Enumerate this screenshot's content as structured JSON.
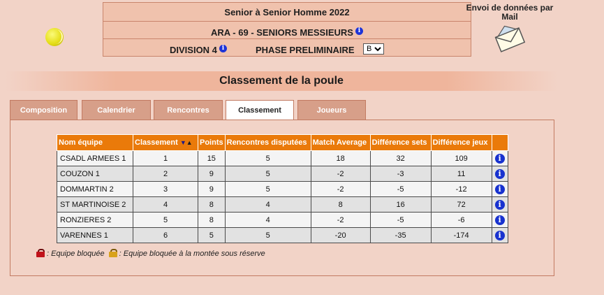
{
  "header": {
    "title": "Senior  à Senior Homme  2022",
    "league": "ARA - 69 - SENIORS MESSIEURS",
    "division": "DIVISION 4",
    "phase": "PHASE PRELIMINAIRE",
    "poule_select": "B"
  },
  "mail": {
    "label": "Envoi de données par Mail"
  },
  "section": {
    "title": "Classement de la poule"
  },
  "tabs": [
    {
      "label": "Composition",
      "active": false
    },
    {
      "label": "Calendrier",
      "active": false
    },
    {
      "label": "Rencontres",
      "active": false
    },
    {
      "label": "Classement",
      "active": true
    },
    {
      "label": "Joueurs",
      "active": false
    }
  ],
  "table": {
    "columns": [
      "Nom équipe",
      "Classement",
      "Points",
      "Rencontres disputées",
      "Match Average",
      "Différence sets",
      "Différence jeux"
    ],
    "rows": [
      {
        "team": "CSADL ARMEES 1",
        "rank": "1",
        "points": "15",
        "played": "5",
        "match_avg": "18",
        "diff_sets": "32",
        "diff_games": "109"
      },
      {
        "team": "COUZON 1",
        "rank": "2",
        "points": "9",
        "played": "5",
        "match_avg": "-2",
        "diff_sets": "-3",
        "diff_games": "11"
      },
      {
        "team": "DOMMARTIN 2",
        "rank": "3",
        "points": "9",
        "played": "5",
        "match_avg": "-2",
        "diff_sets": "-5",
        "diff_games": "-12"
      },
      {
        "team": "ST MARTINOISE 2",
        "rank": "4",
        "points": "8",
        "played": "4",
        "match_avg": "8",
        "diff_sets": "16",
        "diff_games": "72"
      },
      {
        "team": "RONZIERES 2",
        "rank": "5",
        "points": "8",
        "played": "4",
        "match_avg": "-2",
        "diff_sets": "-5",
        "diff_games": "-6"
      },
      {
        "team": "VARENNES 1",
        "rank": "6",
        "points": "5",
        "played": "5",
        "match_avg": "-20",
        "diff_sets": "-35",
        "diff_games": "-174"
      }
    ]
  },
  "legend": {
    "blocked": ": Equipe bloquée",
    "blocked_promotion": ": Equipe bloquée à la montée sous réserve"
  },
  "colors": {
    "background": "#f2d3c7",
    "table_header": "#ea7a0a",
    "tab": "#d79f89",
    "info": "#1832cf"
  }
}
